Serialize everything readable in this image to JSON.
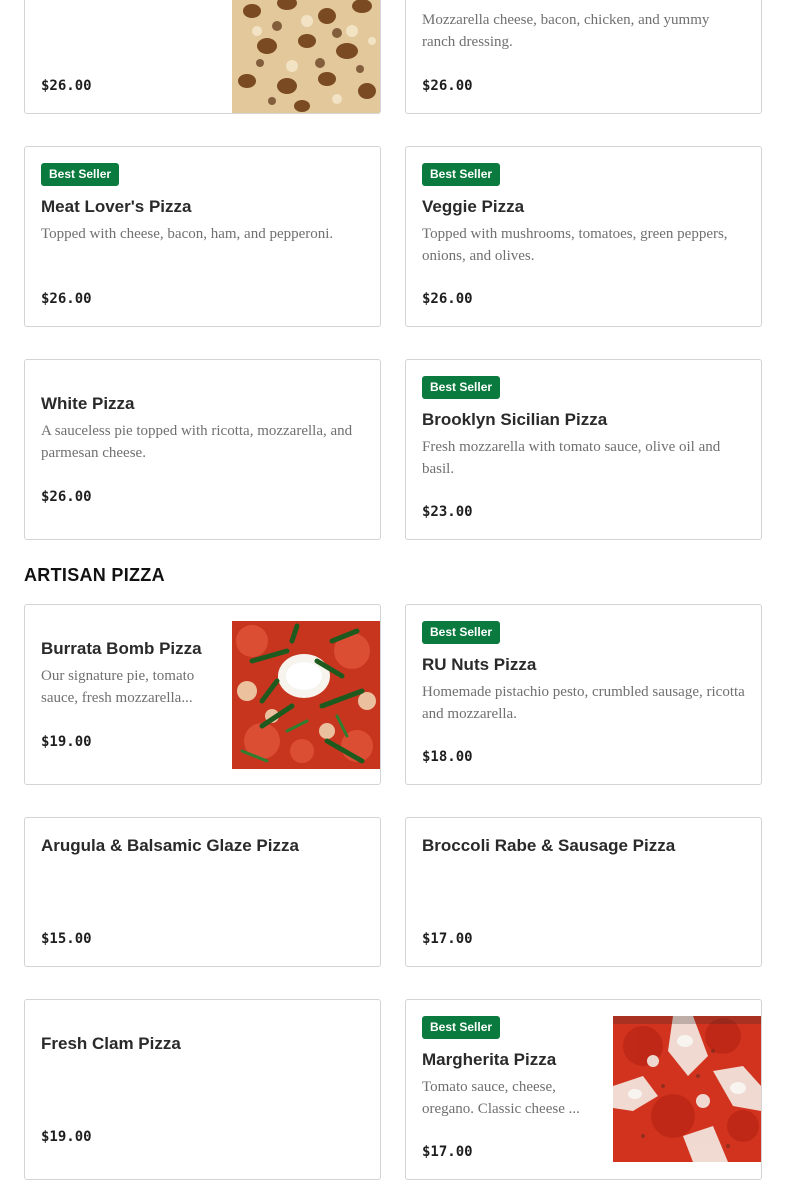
{
  "badge_label": "Best Seller",
  "sections": [
    {
      "title": "ARTISAN PIZZA"
    }
  ],
  "items": [
    {
      "name": "",
      "description": "",
      "price": "$26.00",
      "best_seller": false
    },
    {
      "name": "",
      "description": "Mozzarella cheese, bacon, chicken, and yummy ranch dressing.",
      "price": "$26.00",
      "best_seller": false
    },
    {
      "name": "Meat Lover's Pizza",
      "description": "Topped with cheese, bacon, ham, and pepperoni.",
      "price": "$26.00",
      "best_seller": true
    },
    {
      "name": "Veggie Pizza",
      "description": "Topped with mushrooms, tomatoes, green peppers, onions, and olives.",
      "price": "$26.00",
      "best_seller": true
    },
    {
      "name": "White Pizza",
      "description": "A sauceless pie topped with ricotta, mozzarella, and parmesan cheese.",
      "price": "$26.00",
      "best_seller": false
    },
    {
      "name": "Brooklyn Sicilian Pizza",
      "description": "Fresh mozzarella with tomato sauce, olive oil and basil.",
      "price": "$23.00",
      "best_seller": true
    },
    {
      "name": "Burrata Bomb Pizza",
      "description": "Our signature pie, tomato sauce, fresh mozzarella...",
      "price": "$19.00",
      "best_seller": false
    },
    {
      "name": "RU Nuts Pizza",
      "description": "Homemade pistachio pesto, crumbled sausage, ricotta and mozzarella.",
      "price": "$18.00",
      "best_seller": true
    },
    {
      "name": "Arugula & Balsamic Glaze Pizza",
      "description": "",
      "price": "$15.00",
      "best_seller": false
    },
    {
      "name": "Broccoli Rabe & Sausage Pizza",
      "description": "",
      "price": "$17.00",
      "best_seller": false
    },
    {
      "name": "Fresh Clam Pizza",
      "description": "",
      "price": "$19.00",
      "best_seller": false
    },
    {
      "name": "Margherita Pizza",
      "description": "Tomato sauce, cheese, oregano. Classic cheese ...",
      "price": "$17.00",
      "best_seller": true
    }
  ],
  "colors": {
    "badge": "#0b7a3e",
    "border": "#d4d4d4",
    "description": "#707070"
  }
}
